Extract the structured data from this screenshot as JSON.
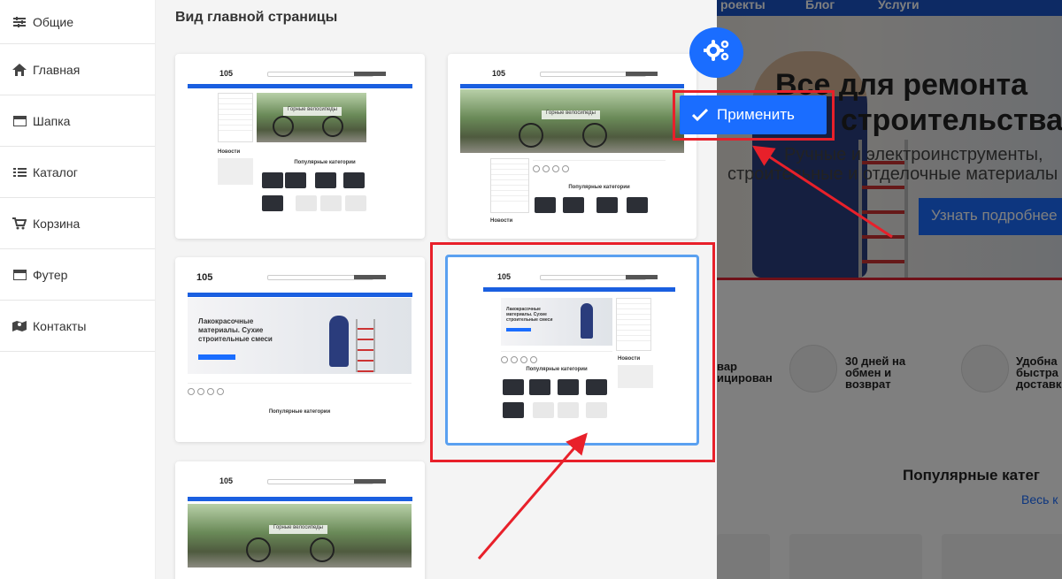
{
  "sidebar": {
    "items": [
      {
        "label": "Общие",
        "icon": "sliders-icon"
      },
      {
        "label": "Главная",
        "icon": "home-icon"
      },
      {
        "label": "Шапка",
        "icon": "window-icon"
      },
      {
        "label": "Каталог",
        "icon": "list-icon"
      },
      {
        "label": "Корзина",
        "icon": "cart-icon"
      },
      {
        "label": "Футер",
        "icon": "window-icon"
      },
      {
        "label": "Контакты",
        "icon": "map-icon"
      }
    ]
  },
  "panel": {
    "title": "Вид главной страницы",
    "thumbs": {
      "t1": {
        "logo": "105",
        "caption": "Горные велосипеды",
        "popular": "Популярные категории",
        "news": "Новости"
      },
      "t2": {
        "logo": "105",
        "caption": "Горные велосипеды",
        "popular": "Популярные категории",
        "news": "Новости"
      },
      "t3": {
        "logo": "105",
        "hero_text": "Лакокрасочные материалы. Сухие строительные смеси",
        "popular": "Популярные категории"
      },
      "t4": {
        "logo": "105",
        "hero_text": "Лакокрасочные материалы. Сухие строительные смеси",
        "popular": "Популярные категории",
        "news": "Новости"
      },
      "t5": {
        "logo": "105",
        "caption": "Горные велосипеды"
      }
    }
  },
  "preview": {
    "nav": [
      "роекты",
      "Блог",
      "Услуги"
    ],
    "hero_line1": "Все для ремонта",
    "hero_line2": "строительства",
    "hero_sub1": "Ручные и электроинструменты,",
    "hero_sub2": "строительные и отделочные материалы",
    "hero_cta": "Узнать подробнее",
    "feature1": [
      "вар",
      "ицирован"
    ],
    "feature2": [
      "30 дней на",
      "обмен и",
      "возврат"
    ],
    "feature3": [
      "Удобна",
      "быстра",
      "доставк"
    ],
    "popular": "Популярные катег",
    "see_all": "Весь к"
  },
  "controls": {
    "apply_label": "Применить",
    "gear_icon": "gears-icon"
  },
  "colors": {
    "accent": "#1a6dff",
    "highlight": "#e8202a"
  }
}
